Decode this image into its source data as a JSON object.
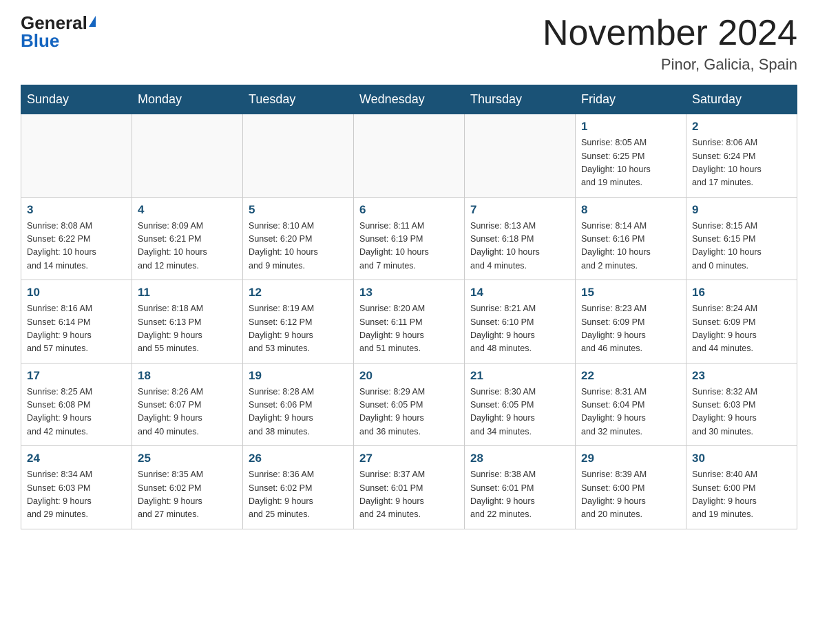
{
  "header": {
    "logo_general": "General",
    "logo_blue": "Blue",
    "title": "November 2024",
    "subtitle": "Pinor, Galicia, Spain"
  },
  "weekdays": [
    "Sunday",
    "Monday",
    "Tuesday",
    "Wednesday",
    "Thursday",
    "Friday",
    "Saturday"
  ],
  "weeks": [
    [
      {
        "day": "",
        "info": ""
      },
      {
        "day": "",
        "info": ""
      },
      {
        "day": "",
        "info": ""
      },
      {
        "day": "",
        "info": ""
      },
      {
        "day": "",
        "info": ""
      },
      {
        "day": "1",
        "info": "Sunrise: 8:05 AM\nSunset: 6:25 PM\nDaylight: 10 hours\nand 19 minutes."
      },
      {
        "day": "2",
        "info": "Sunrise: 8:06 AM\nSunset: 6:24 PM\nDaylight: 10 hours\nand 17 minutes."
      }
    ],
    [
      {
        "day": "3",
        "info": "Sunrise: 8:08 AM\nSunset: 6:22 PM\nDaylight: 10 hours\nand 14 minutes."
      },
      {
        "day": "4",
        "info": "Sunrise: 8:09 AM\nSunset: 6:21 PM\nDaylight: 10 hours\nand 12 minutes."
      },
      {
        "day": "5",
        "info": "Sunrise: 8:10 AM\nSunset: 6:20 PM\nDaylight: 10 hours\nand 9 minutes."
      },
      {
        "day": "6",
        "info": "Sunrise: 8:11 AM\nSunset: 6:19 PM\nDaylight: 10 hours\nand 7 minutes."
      },
      {
        "day": "7",
        "info": "Sunrise: 8:13 AM\nSunset: 6:18 PM\nDaylight: 10 hours\nand 4 minutes."
      },
      {
        "day": "8",
        "info": "Sunrise: 8:14 AM\nSunset: 6:16 PM\nDaylight: 10 hours\nand 2 minutes."
      },
      {
        "day": "9",
        "info": "Sunrise: 8:15 AM\nSunset: 6:15 PM\nDaylight: 10 hours\nand 0 minutes."
      }
    ],
    [
      {
        "day": "10",
        "info": "Sunrise: 8:16 AM\nSunset: 6:14 PM\nDaylight: 9 hours\nand 57 minutes."
      },
      {
        "day": "11",
        "info": "Sunrise: 8:18 AM\nSunset: 6:13 PM\nDaylight: 9 hours\nand 55 minutes."
      },
      {
        "day": "12",
        "info": "Sunrise: 8:19 AM\nSunset: 6:12 PM\nDaylight: 9 hours\nand 53 minutes."
      },
      {
        "day": "13",
        "info": "Sunrise: 8:20 AM\nSunset: 6:11 PM\nDaylight: 9 hours\nand 51 minutes."
      },
      {
        "day": "14",
        "info": "Sunrise: 8:21 AM\nSunset: 6:10 PM\nDaylight: 9 hours\nand 48 minutes."
      },
      {
        "day": "15",
        "info": "Sunrise: 8:23 AM\nSunset: 6:09 PM\nDaylight: 9 hours\nand 46 minutes."
      },
      {
        "day": "16",
        "info": "Sunrise: 8:24 AM\nSunset: 6:09 PM\nDaylight: 9 hours\nand 44 minutes."
      }
    ],
    [
      {
        "day": "17",
        "info": "Sunrise: 8:25 AM\nSunset: 6:08 PM\nDaylight: 9 hours\nand 42 minutes."
      },
      {
        "day": "18",
        "info": "Sunrise: 8:26 AM\nSunset: 6:07 PM\nDaylight: 9 hours\nand 40 minutes."
      },
      {
        "day": "19",
        "info": "Sunrise: 8:28 AM\nSunset: 6:06 PM\nDaylight: 9 hours\nand 38 minutes."
      },
      {
        "day": "20",
        "info": "Sunrise: 8:29 AM\nSunset: 6:05 PM\nDaylight: 9 hours\nand 36 minutes."
      },
      {
        "day": "21",
        "info": "Sunrise: 8:30 AM\nSunset: 6:05 PM\nDaylight: 9 hours\nand 34 minutes."
      },
      {
        "day": "22",
        "info": "Sunrise: 8:31 AM\nSunset: 6:04 PM\nDaylight: 9 hours\nand 32 minutes."
      },
      {
        "day": "23",
        "info": "Sunrise: 8:32 AM\nSunset: 6:03 PM\nDaylight: 9 hours\nand 30 minutes."
      }
    ],
    [
      {
        "day": "24",
        "info": "Sunrise: 8:34 AM\nSunset: 6:03 PM\nDaylight: 9 hours\nand 29 minutes."
      },
      {
        "day": "25",
        "info": "Sunrise: 8:35 AM\nSunset: 6:02 PM\nDaylight: 9 hours\nand 27 minutes."
      },
      {
        "day": "26",
        "info": "Sunrise: 8:36 AM\nSunset: 6:02 PM\nDaylight: 9 hours\nand 25 minutes."
      },
      {
        "day": "27",
        "info": "Sunrise: 8:37 AM\nSunset: 6:01 PM\nDaylight: 9 hours\nand 24 minutes."
      },
      {
        "day": "28",
        "info": "Sunrise: 8:38 AM\nSunset: 6:01 PM\nDaylight: 9 hours\nand 22 minutes."
      },
      {
        "day": "29",
        "info": "Sunrise: 8:39 AM\nSunset: 6:00 PM\nDaylight: 9 hours\nand 20 minutes."
      },
      {
        "day": "30",
        "info": "Sunrise: 8:40 AM\nSunset: 6:00 PM\nDaylight: 9 hours\nand 19 minutes."
      }
    ]
  ]
}
